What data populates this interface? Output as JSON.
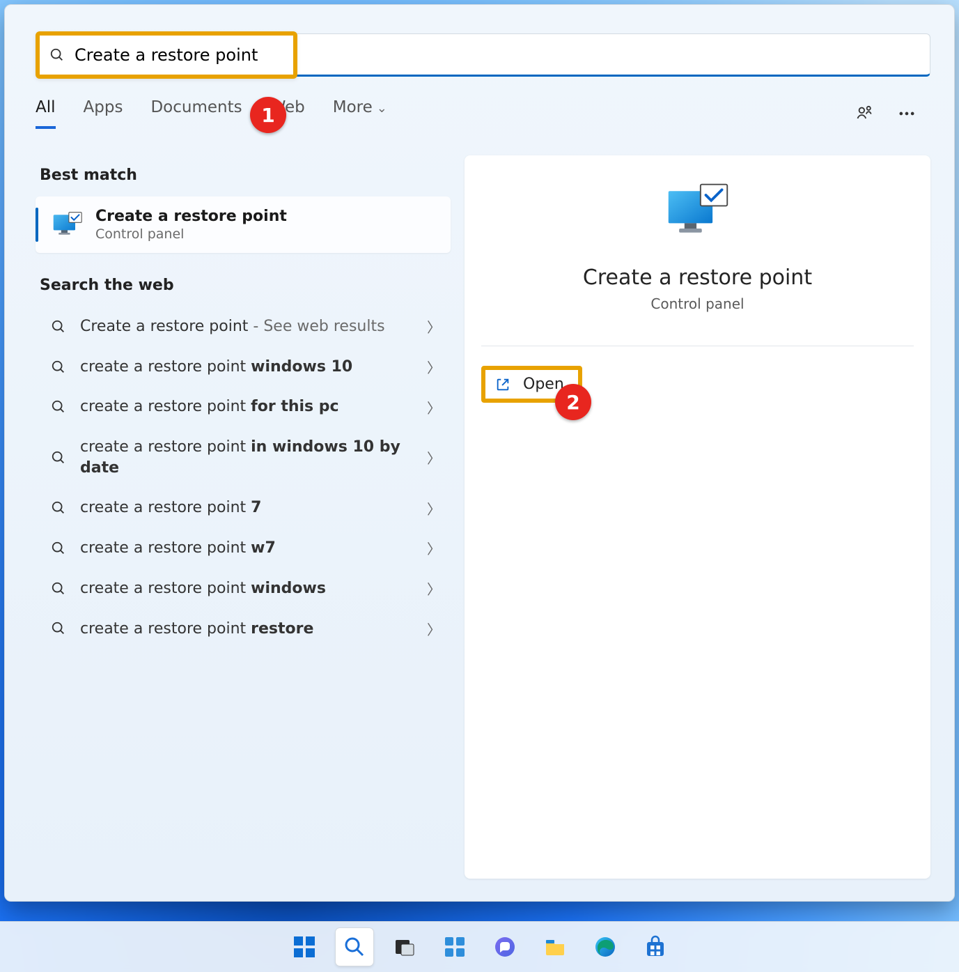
{
  "search": {
    "value": "Create a restore point"
  },
  "tabs": {
    "all": "All",
    "apps": "Apps",
    "documents": "Documents",
    "web": "Web",
    "more": "More"
  },
  "sections": {
    "best": "Best match",
    "web": "Search the web"
  },
  "bestMatch": {
    "title": "Create a restore point",
    "subtitle": "Control panel"
  },
  "webResults": [
    {
      "pre": "Create a restore point",
      "bold": "",
      "suffix": " - See web results"
    },
    {
      "pre": "create a restore point ",
      "bold": "windows 10",
      "suffix": ""
    },
    {
      "pre": "create a restore point ",
      "bold": "for this pc",
      "suffix": ""
    },
    {
      "pre": "create a restore point ",
      "bold": "in windows 10 by date",
      "suffix": ""
    },
    {
      "pre": "create a restore point ",
      "bold": "7",
      "suffix": ""
    },
    {
      "pre": "create a restore point ",
      "bold": "w7",
      "suffix": ""
    },
    {
      "pre": "create a restore point ",
      "bold": "windows",
      "suffix": ""
    },
    {
      "pre": "create a restore point ",
      "bold": "restore",
      "suffix": ""
    }
  ],
  "preview": {
    "title": "Create a restore point",
    "subtitle": "Control panel",
    "open": "Open"
  },
  "annotations": {
    "b1": "1",
    "b2": "2"
  },
  "taskbar": {
    "items": [
      "start",
      "search",
      "task-view",
      "widgets",
      "chat",
      "file-explorer",
      "edge",
      "store"
    ]
  }
}
